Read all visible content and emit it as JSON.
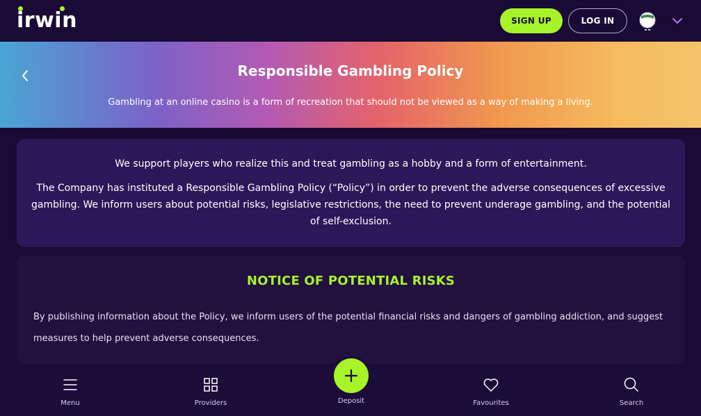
{
  "header": {
    "logo_text": "irwin",
    "signup_label": "SIGN UP",
    "login_label": "LOG IN"
  },
  "hero": {
    "title": "Responsible Gambling Policy",
    "subtitle": "Gambling at an online casino is a form of recreation that should not be viewed as a way of making a living."
  },
  "intro_card": {
    "paragraph1": "We support players who realize this and treat gambling as a hobby and a form of entertainment.",
    "paragraph2": "The Company has instituted a Responsible Gambling Policy (“Policy”) in order to prevent the adverse consequences of excessive gambling. We inform users about potential risks, legislative restrictions, the need to prevent underage gambling, and the potential of self-exclusion."
  },
  "risks_card": {
    "heading": "NOTICE OF POTENTIAL RISKS",
    "body": "By publishing information about the Policy, we inform users of the potential financial risks and dangers of gambling addiction, and suggest measures to help prevent adverse consequences."
  },
  "bottom_nav": {
    "menu": "Menu",
    "providers": "Providers",
    "deposit": "Deposit",
    "favourites": "Favourites",
    "search": "Search"
  },
  "colors": {
    "accent": "#a6f32a",
    "background": "#1a0b36",
    "card": "#2c1858"
  },
  "icons": {
    "back": "chevron-left-icon",
    "account_menu": "chevron-down-icon",
    "menu": "hamburger-icon",
    "providers": "grid-icon",
    "deposit": "plus-icon",
    "favourites": "heart-icon",
    "search": "search-icon"
  }
}
